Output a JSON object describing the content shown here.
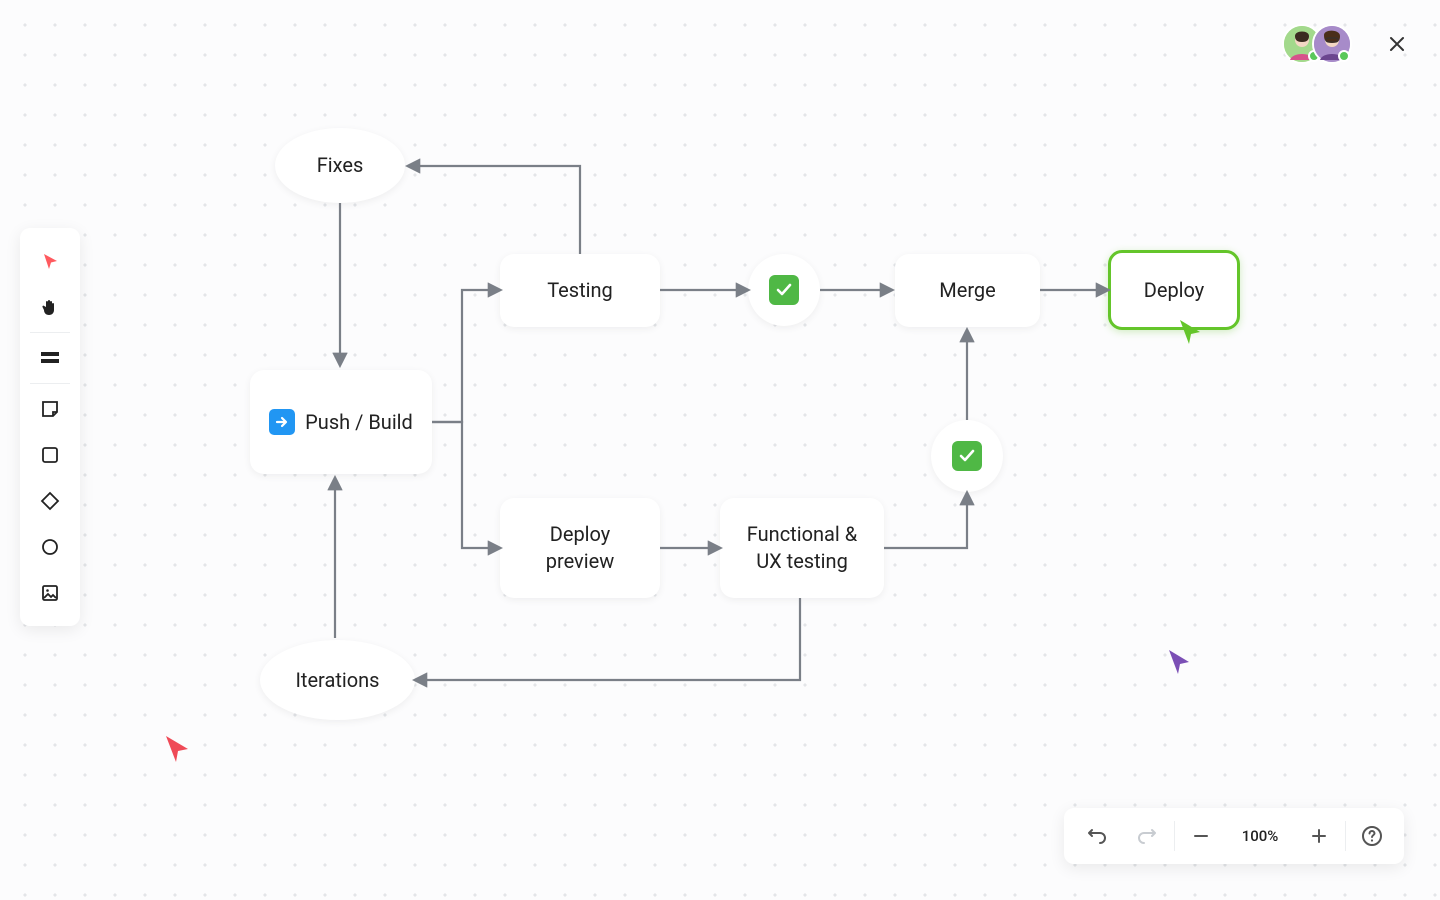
{
  "zoom_level": "100%",
  "nodes": {
    "fixes": "Fixes",
    "push_build": "Push / Build",
    "testing": "Testing",
    "deploy_preview": "Deploy preview",
    "functional_ux": "Functional & UX testing",
    "merge": "Merge",
    "deploy": "Deploy",
    "iterations": "Iterations"
  },
  "icons": {
    "push_build_prefix": "arrow-right-icon",
    "check": "check-icon"
  },
  "cursors": {
    "green_selecting": "Deploy",
    "positions": [
      "red-bottom-left",
      "green-on-deploy",
      "purple-right"
    ]
  },
  "connections": [
    {
      "from": "Fixes",
      "to": "Push / Build",
      "dir": "down"
    },
    {
      "from": "Push / Build",
      "to": "Testing",
      "dir": "right-up"
    },
    {
      "from": "Push / Build",
      "to": "Deploy preview",
      "dir": "right-down"
    },
    {
      "from": "Testing",
      "to": "check-1",
      "dir": "right"
    },
    {
      "from": "check-1",
      "to": "Merge",
      "dir": "right"
    },
    {
      "from": "Merge",
      "to": "Deploy",
      "dir": "right"
    },
    {
      "from": "Deploy preview",
      "to": "Functional & UX testing",
      "dir": "right"
    },
    {
      "from": "Functional & UX testing",
      "to": "check-2",
      "dir": "right-up"
    },
    {
      "from": "check-2",
      "to": "Merge",
      "dir": "up"
    },
    {
      "from": "Testing",
      "to": "Fixes",
      "dir": "up-left",
      "note": "feedback loop"
    },
    {
      "from": "Functional & UX testing",
      "to": "Iterations",
      "dir": "down-left"
    },
    {
      "from": "Iterations",
      "to": "Push / Build",
      "dir": "up"
    }
  ],
  "toolbar_tools": [
    "select",
    "hand",
    "section",
    "sticky-note",
    "rectangle",
    "diamond",
    "circle",
    "image"
  ],
  "bottom_bar": [
    "undo",
    "redo",
    "zoom-out",
    "zoom-level",
    "zoom-in",
    "help"
  ],
  "collaborators": [
    {
      "color": "#8bc34a",
      "avatar_bg": "#9ed884"
    },
    {
      "color": "#7b4fb5",
      "avatar_bg": "#a78bc9"
    }
  ]
}
